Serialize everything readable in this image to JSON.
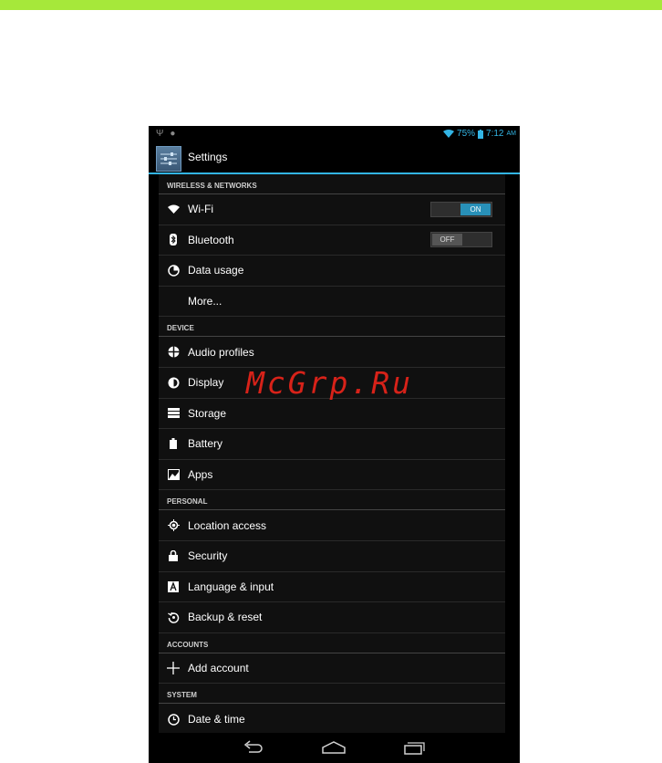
{
  "status": {
    "battery": "75%",
    "time": "7:12",
    "ampm": "AM",
    "accent": "#33b5e5"
  },
  "action_bar": {
    "title": "Settings"
  },
  "sections": [
    {
      "header": "WIRELESS & NETWORKS",
      "items": [
        {
          "label": "Wi-Fi",
          "icon": "wifi-icon",
          "toggle": "ON"
        },
        {
          "label": "Bluetooth",
          "icon": "bluetooth-icon",
          "toggle": "OFF"
        },
        {
          "label": "Data usage",
          "icon": "data-usage-icon"
        },
        {
          "label": "More..."
        }
      ]
    },
    {
      "header": "DEVICE",
      "items": [
        {
          "label": "Audio profiles",
          "icon": "audio-profiles-icon"
        },
        {
          "label": "Display",
          "icon": "display-icon"
        },
        {
          "label": "Storage",
          "icon": "storage-icon"
        },
        {
          "label": "Battery",
          "icon": "battery-icon"
        },
        {
          "label": "Apps",
          "icon": "apps-icon"
        }
      ]
    },
    {
      "header": "PERSONAL",
      "items": [
        {
          "label": "Location access",
          "icon": "location-icon"
        },
        {
          "label": "Security",
          "icon": "lock-icon"
        },
        {
          "label": "Language & input",
          "icon": "language-icon"
        },
        {
          "label": "Backup & reset",
          "icon": "backup-icon"
        }
      ]
    },
    {
      "header": "ACCOUNTS",
      "items": [
        {
          "label": "Add account",
          "icon": "plus-icon"
        }
      ]
    },
    {
      "header": "SYSTEM",
      "items": [
        {
          "label": "Date & time",
          "icon": "clock-icon"
        }
      ]
    }
  ],
  "watermark": "McGrp.Ru",
  "nav": [
    "back-icon",
    "home-icon",
    "recent-apps-icon"
  ]
}
